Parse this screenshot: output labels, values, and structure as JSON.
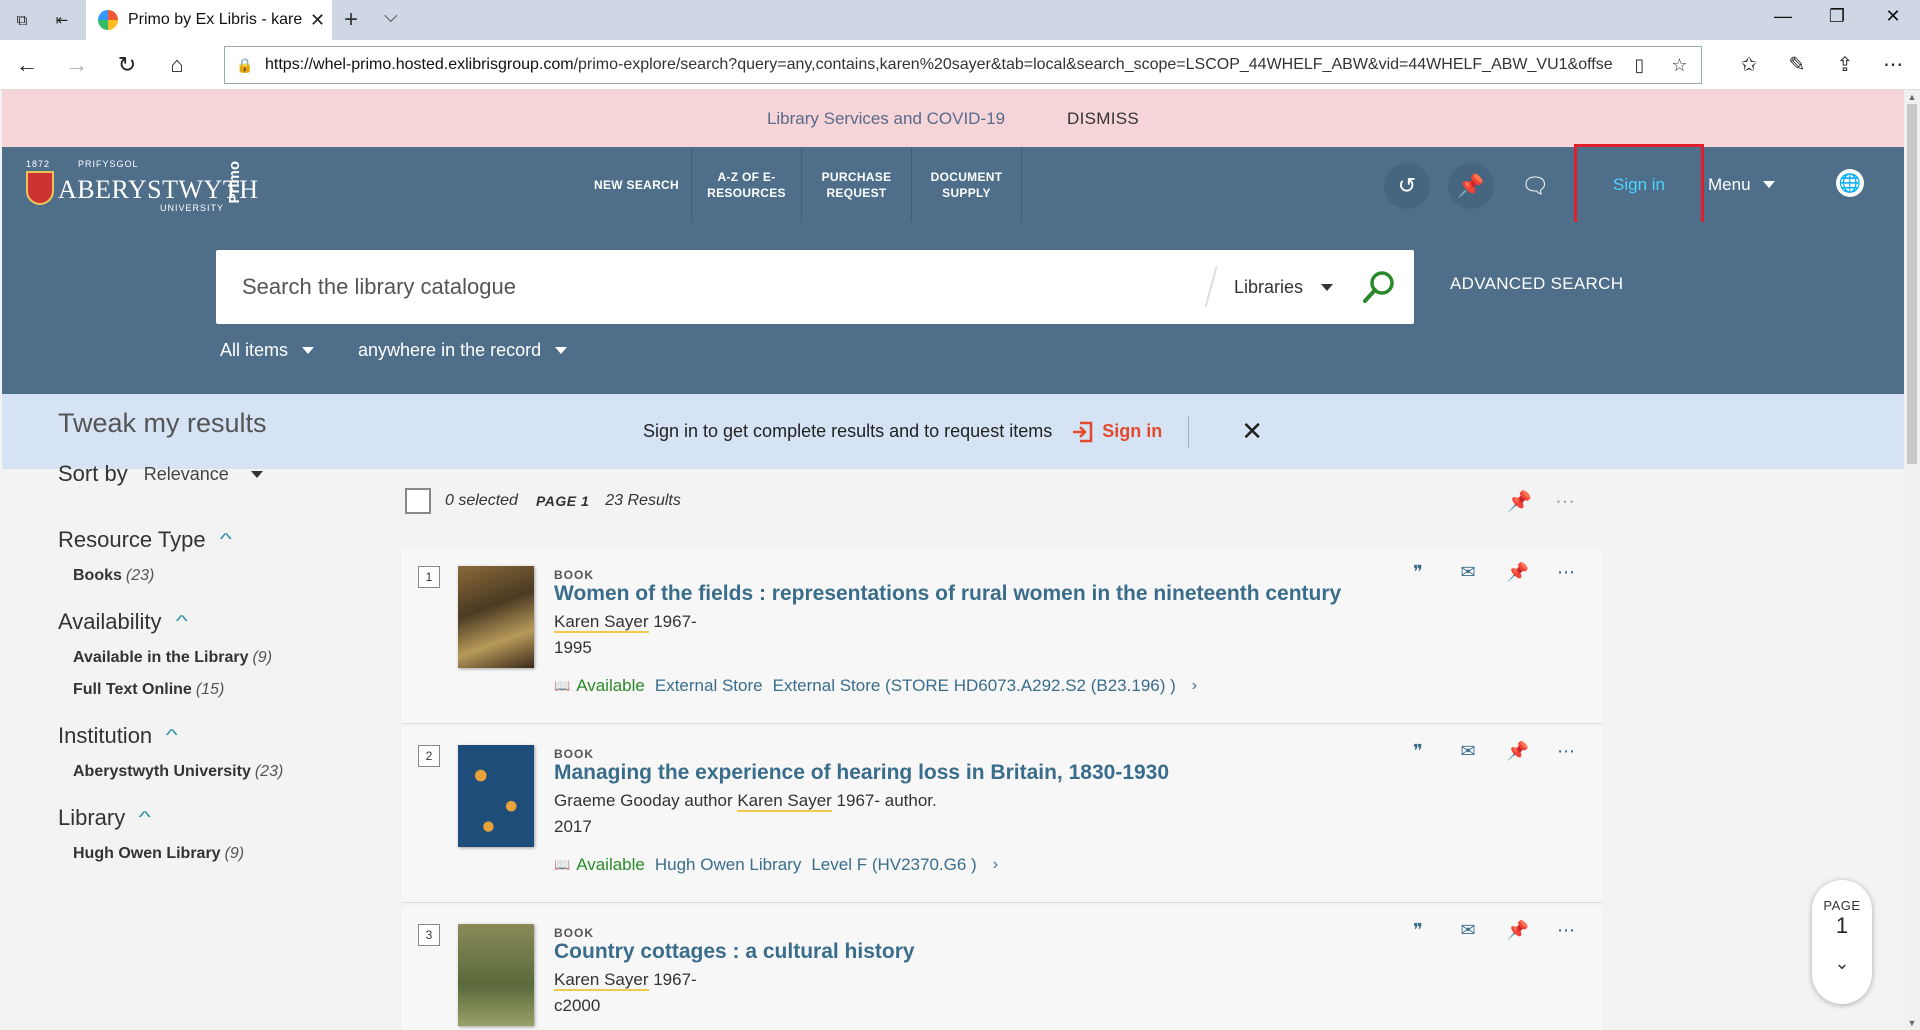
{
  "browser": {
    "tab_title": "Primo by Ex Libris - kare",
    "tab_close": "✕",
    "new_tab": "+",
    "tab_menu": "⌵",
    "url_host": "https://whel-primo.hosted.exlibrisgroup.com",
    "url_path": "/primo-explore/search?query=any,contains,karen%20sayer&tab=local&search_scope=LSCOP_44WHELF_ABW&vid=44WHELF_ABW_VU1&offse"
  },
  "covid_banner": {
    "link": "Library Services and COVID-19",
    "dismiss": "DISMISS"
  },
  "header": {
    "logo": {
      "top": "PRIFYSGOL",
      "year": "1872",
      "name": "ABERYSTWYTH",
      "sub": "UNIVERSITY",
      "product": "Primo"
    },
    "nav": [
      "NEW SEARCH",
      "A-Z OF E-RESOURCES",
      "PURCHASE REQUEST",
      "DOCUMENT SUPPLY"
    ],
    "sign_in": "Sign in",
    "menu": "Menu"
  },
  "search": {
    "placeholder": "Search the library catalogue",
    "scope": "Libraries",
    "advanced": "ADVANCED SEARCH",
    "filter_type": "All items",
    "filter_field": "anywhere in the record"
  },
  "signin_bar": {
    "message": "Sign in to get complete results and to request items",
    "link": "Sign in",
    "close": "✕"
  },
  "sidebar": {
    "title": "Tweak my results",
    "sort_label": "Sort by",
    "sort_value": "Relevance",
    "facets": [
      {
        "name": "Resource Type",
        "items": [
          {
            "label": "Books",
            "count": "(23)"
          }
        ]
      },
      {
        "name": "Availability",
        "items": [
          {
            "label": "Available in the Library",
            "count": "(9)"
          },
          {
            "label": "Full Text Online",
            "count": "(15)"
          }
        ]
      },
      {
        "name": "Institution",
        "items": [
          {
            "label": "Aberystwyth University",
            "count": "(23)"
          }
        ]
      },
      {
        "name": "Library",
        "items": [
          {
            "label": "Hugh Owen Library",
            "count": "(9)"
          }
        ]
      }
    ]
  },
  "results_bar": {
    "selected": "0 selected",
    "page": "PAGE 1",
    "count": "23 Results"
  },
  "results": [
    {
      "num": "1",
      "type": "BOOK",
      "title": "Women of the fields : representations of rural women in the nineteenth century",
      "author_highlight": "Karen Sayer",
      "author_rest": " 1967-",
      "year": "1995",
      "status": "Available",
      "library": "External Store",
      "location": "External Store (STORE HD6073.A292.S2 (B23.196) )"
    },
    {
      "num": "2",
      "type": "BOOK",
      "title": "Managing the experience of hearing loss in Britain, 1830-1930",
      "author_pre": "Graeme Gooday author ",
      "author_highlight": "Karen Sayer",
      "author_rest": " 1967- author.",
      "year": "2017",
      "status": "Available",
      "library": "Hugh Owen Library",
      "location": "Level F (HV2370.G6 )"
    },
    {
      "num": "3",
      "type": "BOOK",
      "title": "Country cottages : a cultural history",
      "author_highlight": "Karen Sayer",
      "author_rest": " 1967-",
      "year": "c2000"
    }
  ],
  "page_badge": {
    "label": "PAGE",
    "number": "1"
  },
  "colors": {
    "header": "#4e6e8a",
    "covid": "#f5d5d8",
    "signin_bar": "#d5e3f5",
    "link": "#3a6d8c",
    "available": "#2a8a2a",
    "highlight_box": "#e01e2c"
  }
}
